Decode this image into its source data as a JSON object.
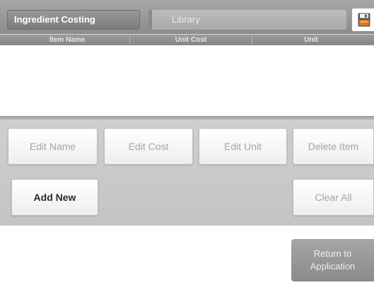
{
  "header": {
    "tabs": [
      {
        "label": "Ingredient Costing",
        "active": true
      },
      {
        "label": "Library",
        "active": false
      }
    ],
    "save_icon": "floppy-disk-icon"
  },
  "table": {
    "columns": [
      "Item Name",
      "Unit Cost",
      "Unit"
    ],
    "rows": []
  },
  "actions": {
    "edit_name": "Edit Name",
    "edit_cost": "Edit Cost",
    "edit_unit": "Edit Unit",
    "delete_item": "Delete Item",
    "add_new": "Add New",
    "clear_all": "Clear All"
  },
  "footer": {
    "return_line1": "Return to",
    "return_line2": "Application"
  },
  "colors": {
    "header_bg": "#8c8c8c",
    "panel_bg": "#c8c8c8",
    "disabled_text": "#a5a5a5",
    "save_icon_orange": "#e07820"
  }
}
